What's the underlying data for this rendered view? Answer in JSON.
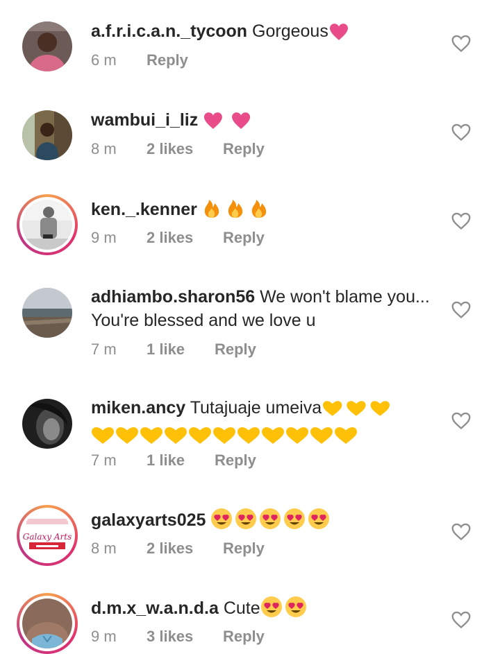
{
  "comments": [
    {
      "username": "a.f.r.i.c.a.n._tycoon",
      "text": "Gorgeous",
      "emoji": "💖",
      "time": "6 m",
      "likes": "",
      "reply": "Reply"
    },
    {
      "username": "wambui_i_liz",
      "text": "",
      "emoji": "💗 💗",
      "time": "8 m",
      "likes": "2 likes",
      "reply": "Reply"
    },
    {
      "username": "ken._.kenner",
      "text": "",
      "emoji": "🔥 🔥 🔥",
      "time": "9 m",
      "likes": "2 likes",
      "reply": "Reply"
    },
    {
      "username": "adhiambo.sharon56",
      "text": "We won't blame you... You're blessed and we love u",
      "emoji": "",
      "time": "7 m",
      "likes": "1 like",
      "reply": "Reply"
    },
    {
      "username": "miken.ancy",
      "text": "Tutajuaje umeiva",
      "emoji": "💛💛💛💛💛💛💛💛💛💛💛💛💛💛",
      "time": "7 m",
      "likes": "1 like",
      "reply": "Reply"
    },
    {
      "username": "galaxyarts025",
      "text": "",
      "emoji": "😍😍😍😍😍",
      "time": "8 m",
      "likes": "2 likes",
      "reply": "Reply"
    },
    {
      "username": "d.m.x_w.a.n.d.a",
      "text": "Cute",
      "emoji": "😍😍",
      "time": "9 m",
      "likes": "3 likes",
      "reply": "Reply"
    }
  ],
  "avatar_logo_text": "Galaxy Arts",
  "colors": {
    "heart_pink": "#e84d8a",
    "fire": "#f4900c",
    "yellow_heart": "#ffc107",
    "emoji_face": "#ffcc4d",
    "meta_gray": "#8e8e8e"
  }
}
